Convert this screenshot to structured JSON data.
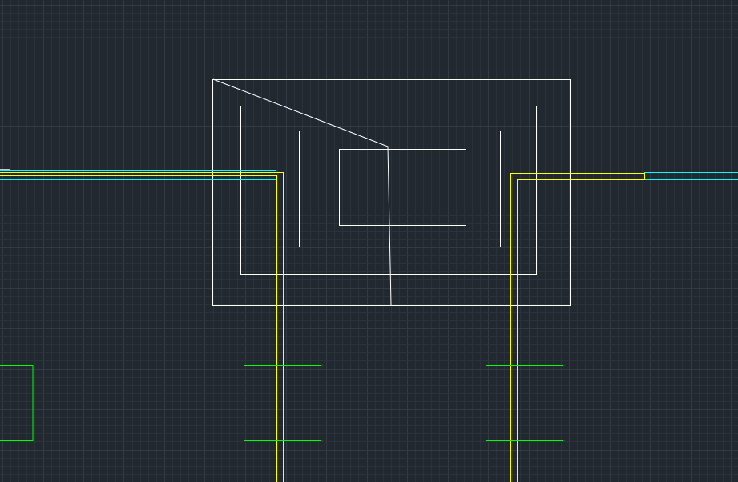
{
  "app": {
    "kind": "cad-model-space",
    "background_color": "#212830"
  },
  "grid": {
    "visible": true,
    "minor_color": "#2b323b",
    "major_color": "#323a45"
  },
  "layers": {
    "outline": {
      "color": "#ffffff"
    },
    "lines": {
      "color": "#ffff00"
    },
    "boxes": {
      "color": "#00ff00"
    },
    "rails": {
      "color": "#00ffff"
    },
    "reference": {
      "color": "#c8c8c8"
    }
  }
}
